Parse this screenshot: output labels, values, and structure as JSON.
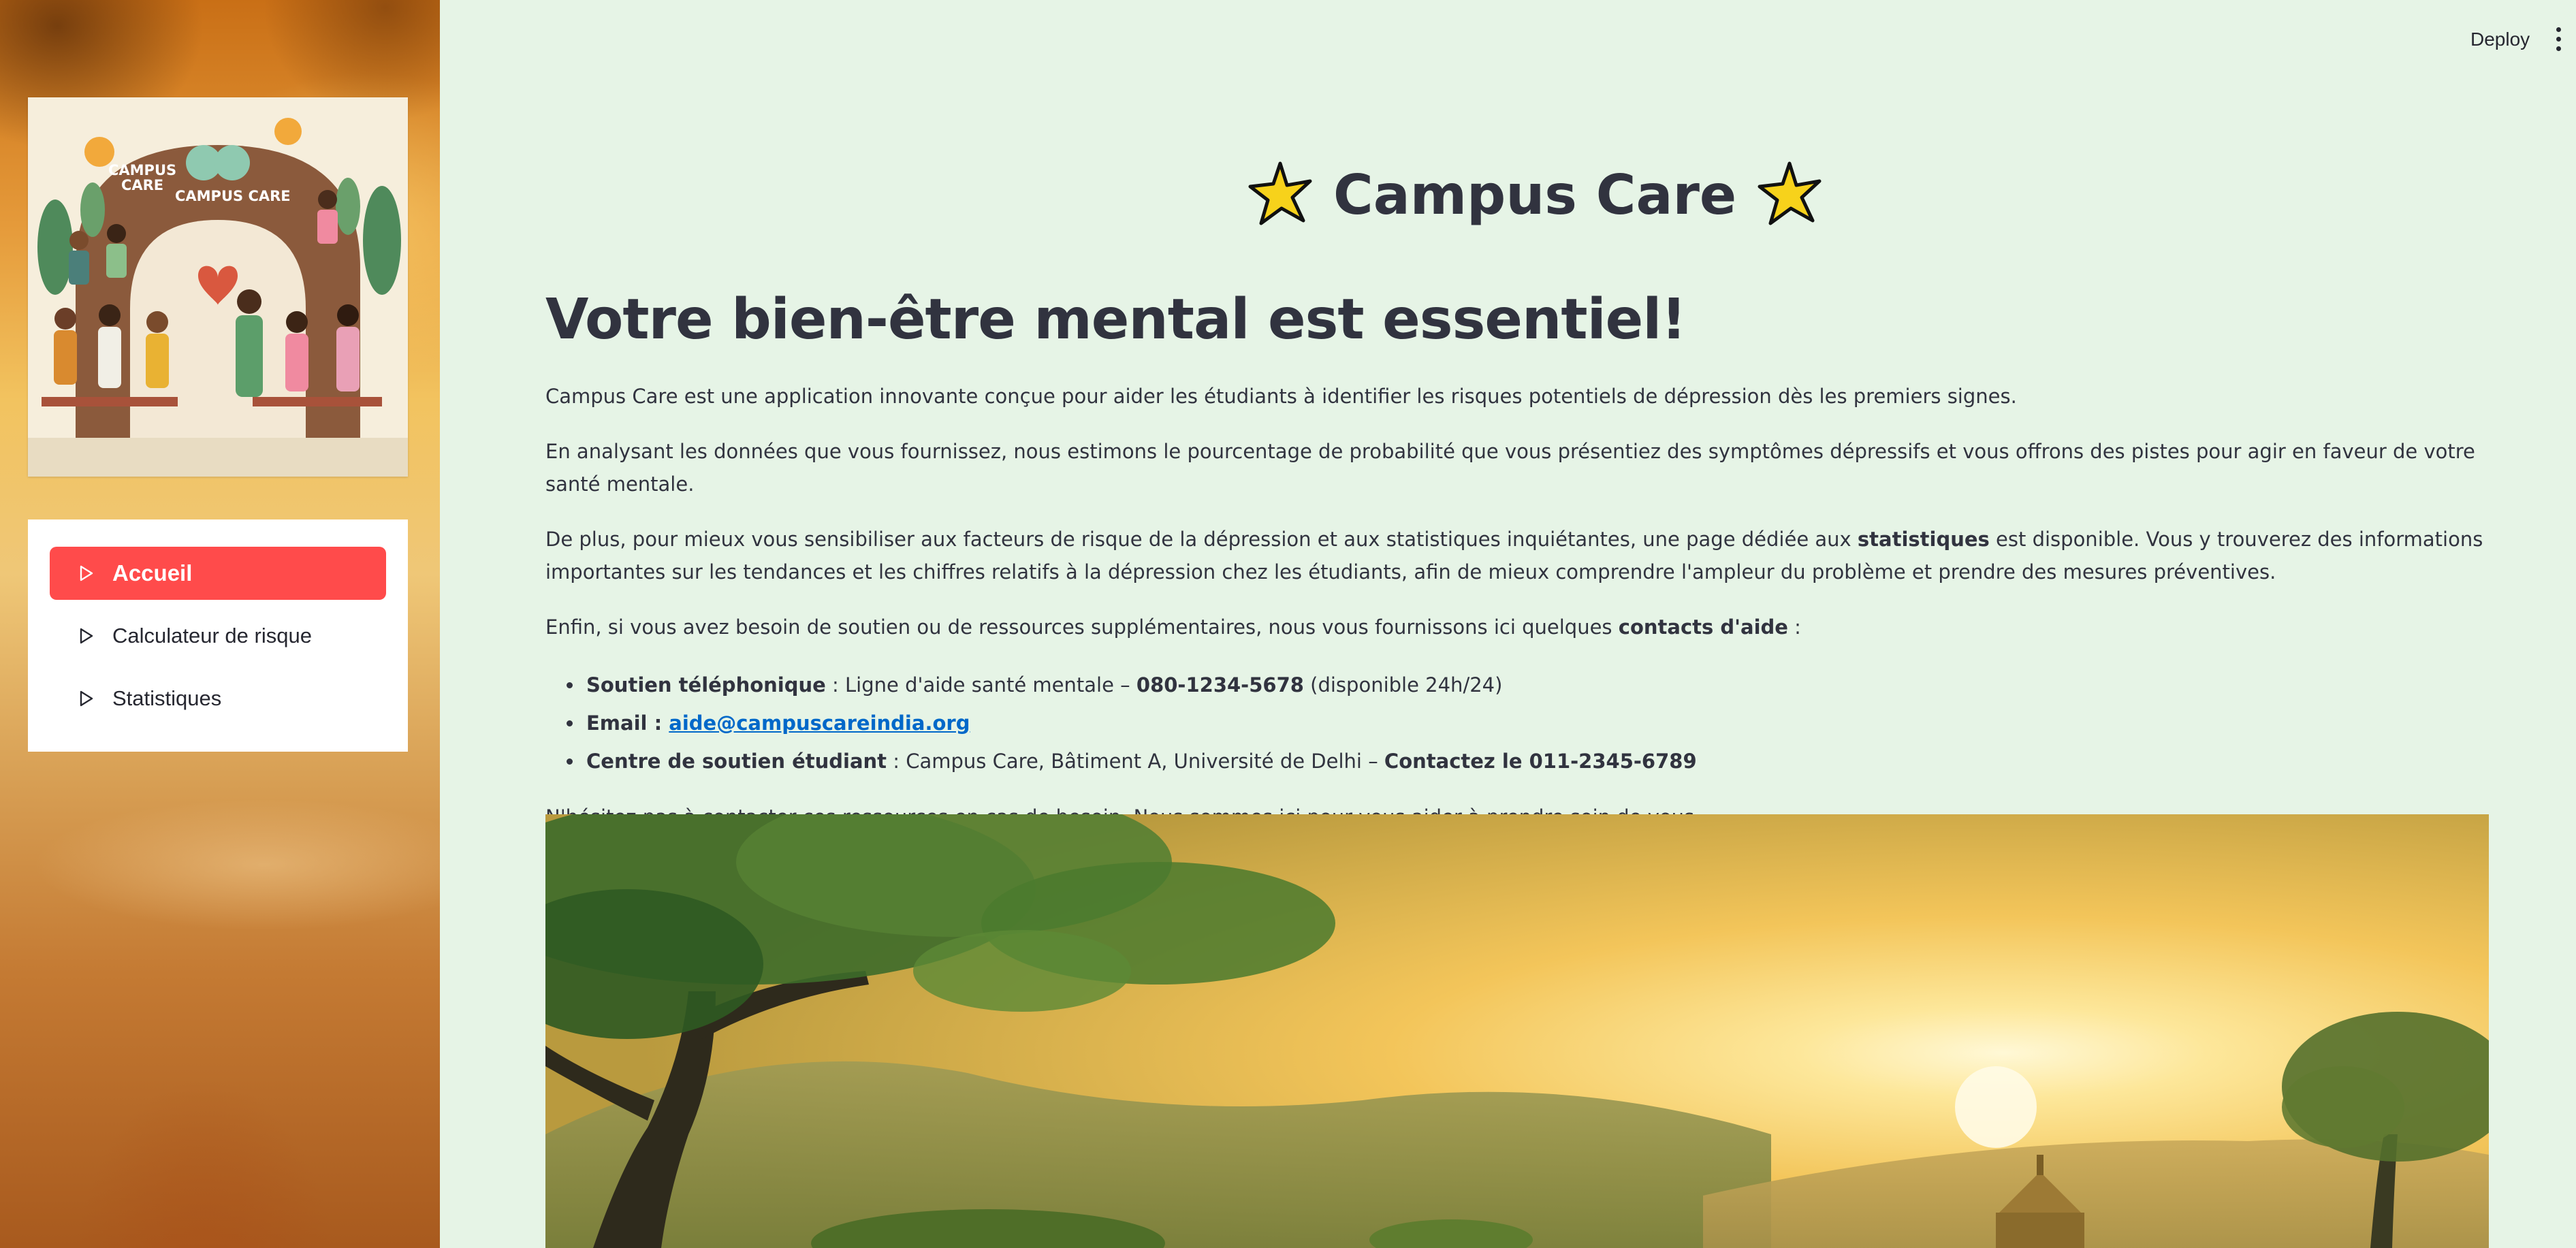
{
  "topbar": {
    "deploy_label": "Deploy",
    "menu_icon": "kebab-menu-icon"
  },
  "sidebar": {
    "logo": {
      "title_line1": "CAMPUS",
      "title_line2": "CARE",
      "banner": "CAMPUS CARE"
    },
    "nav": [
      {
        "label": "Accueil",
        "active": true,
        "icon": "play-triangle-icon"
      },
      {
        "label": "Calculateur de risque",
        "active": false,
        "icon": "play-triangle-icon"
      },
      {
        "label": "Statistiques",
        "active": false,
        "icon": "play-triangle-icon"
      }
    ]
  },
  "main": {
    "app_title": "Campus Care",
    "title_icon": "star-icon",
    "heading": "Votre bien-être mental est essentiel!",
    "intro": "Campus Care est une application innovante conçue pour aider les étudiants à identifier les risques potentiels de dépression dès les premiers signes.",
    "analysis": "En analysant les données que vous fournissez, nous estimons le pourcentage de probabilité que vous présentiez des symptômes dépressifs et vous offrons des pistes pour agir en faveur de votre santé mentale.",
    "stats_before": "De plus, pour mieux vous sensibiliser aux facteurs de risque de la dépression et aux statistiques inquiétantes, une page dédiée aux ",
    "stats_bold": "statistiques",
    "stats_after": " est disponible. Vous y trouverez des informations importantes sur les tendances et les chiffres relatifs à la dépression chez les étudiants, afin de mieux comprendre l'ampleur du problème et prendre des mesures préventives.",
    "support_before": "Enfin, si vous avez besoin de soutien ou de ressources supplémentaires, nous vous fournissons ici quelques ",
    "support_bold": "contacts d'aide",
    "support_after": " :",
    "contacts": {
      "phone_label": "Soutien téléphonique",
      "phone_text": " : Ligne d'aide santé mentale – ",
      "phone_number": "080-1234-5678",
      "phone_suffix": " (disponible 24h/24)",
      "email_label": "Email",
      "email_sep": " : ",
      "email": "aide@campuscareindia.org",
      "center_label": "Centre de soutien étudiant",
      "center_text": " : Campus Care, Bâtiment A, Université de Delhi – ",
      "center_contact": "Contactez le 011-2345-6789"
    },
    "closing": "N'hésitez pas à contacter ces ressources en cas de besoin. Nous sommes ici pour vous aider à prendre soin de vous."
  },
  "colors": {
    "main_bg": "#e6f4e6",
    "active_nav": "#ff4b4b",
    "link": "#0068c9",
    "text": "#31333f",
    "star_fill": "#f7d21b"
  }
}
